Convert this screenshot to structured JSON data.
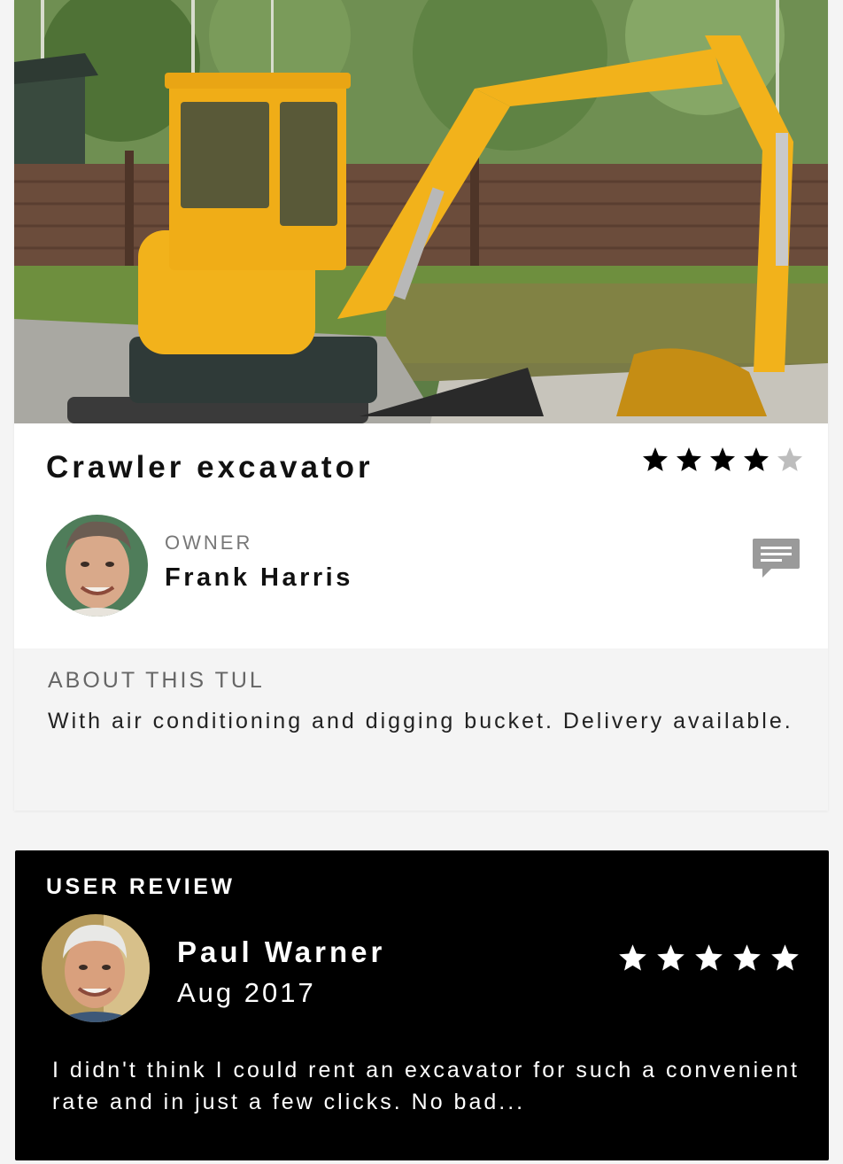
{
  "listing": {
    "image_alt": "Yellow crawler excavator parked in front of a wooden fence",
    "title": "Crawler excavator",
    "rating": 4,
    "max_rating": 5
  },
  "owner": {
    "label": "OWNER",
    "name": "Frank Harris",
    "message_icon": "chat-bubble-icon"
  },
  "about": {
    "heading": "ABOUT THIS TUL",
    "text": "With air conditioning and digging bucket. Delivery available."
  },
  "review": {
    "heading": "USER REVIEW",
    "reviewer_name": "Paul Warner",
    "date": "Aug 2017",
    "rating": 5,
    "max_rating": 5,
    "text": "I didn't think I could rent an excavator for such a convenient rate and in just a few clicks. No bad..."
  },
  "colors": {
    "star_filled_dark": "#000000",
    "star_empty": "#bdbdbd",
    "star_filled_light": "#ffffff",
    "excavator_yellow": "#f2b21b",
    "review_bg": "#000000",
    "about_bg": "#f4f4f4"
  }
}
